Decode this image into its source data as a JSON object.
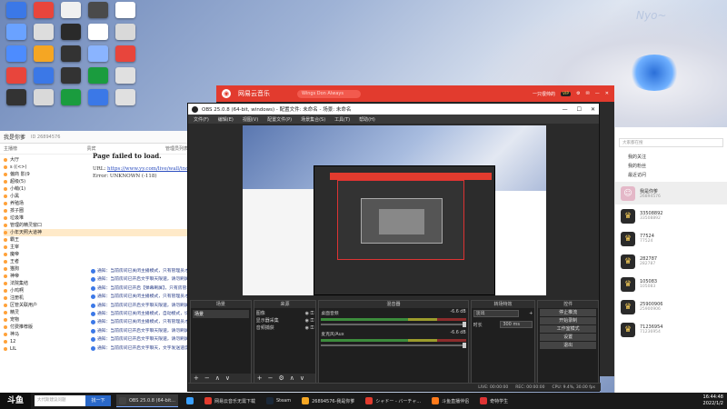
{
  "desktop": {
    "icon_colors": [
      "#3b78e7",
      "#e8453c",
      "#f0f0f0",
      "#4a4a4a",
      "#fff",
      "#6aa2ff",
      "#dddddd",
      "#2a2a2a",
      "#ffffff",
      "#d9d9d9",
      "#4d8cff",
      "#f5a623",
      "#333333",
      "#8ab4ff",
      "#e8453c",
      "#e8453c",
      "#3b78e7",
      "#333333",
      "#1a9c3e",
      "#e0e0e0",
      "#333333",
      "#d9d9d9",
      "#1a9c3e",
      "#3b78e7",
      "#e0e0e0"
    ],
    "wallpaper_text": "Nyo~"
  },
  "client": {
    "room": "我是你爹",
    "room_id": "ID 26894576",
    "tabs": [
      "主播榜",
      "贵宾",
      "管理员列表"
    ],
    "left_items": [
      "大厅",
      "s ((&lt;&gt;)",
      "偏商 影(9",
      "超级(5)",
      "小萌(1)",
      "小黑",
      "养殖场",
      "孩子圈",
      "垃圾堆",
      "管理的精灵窗口",
      "小年天照大道神",
      "霸王",
      "主宰",
      "魔帝",
      "王者",
      "猫狗",
      "神帝",
      "法院集结",
      "小鸡啊",
      "注册机",
      "区管关联用户",
      "精灵",
      "宠物",
      "付费推荐版",
      "神马",
      "12",
      "LIL"
    ],
    "highlight_index": 10
  },
  "webpage": {
    "error_title": "Page failed to load.",
    "url_label": "URL:",
    "url": "https://www.yy.com/live/wall/index.html",
    "error": "Error: UNKNOWN (-118)",
    "notices": [
      "通知：当前房间已关闭主播模式，只有管理员才能",
      "通知：当前房间已开启文字聊天限速，请勿刷屏",
      "通知：当前房间已开启【弹幕刷屏】，只有房管才可以使用",
      "通知：当前房间已关闭主播模式，只有管理员才能",
      "通知：当前房间已开启文字聊天限速，请勿刷屏",
      "通知：当前房间已关闭主播模式，自动模式，切换成功",
      "通知：当前房间已关闭主播模式，只有管理员才能",
      "通知：当前房间已开启文字聊天限速，请勿刷屏",
      "通知：当前房间已开启文字聊天限速，请勿刷屏",
      "通知：当前房间已开启文字聊天，文字发送速度"
    ]
  },
  "music": {
    "app_name": "网易云音乐",
    "search_placeholder": "Wings Don Always",
    "user": "一只很帅的",
    "vip": "VIP"
  },
  "side_panel": {
    "search_placeholder": "大家都在搜",
    "links": [
      "我的关注",
      "我的粉丝",
      "最近访问"
    ],
    "users": [
      {
        "name": "我是你爹",
        "id": "26894576",
        "pink": true
      },
      {
        "name": "33508892",
        "id": "33508892",
        "pink": false
      },
      {
        "name": "77524",
        "id": "77524",
        "pink": false
      },
      {
        "name": "282787",
        "id": "282787",
        "pink": false
      },
      {
        "name": "105083",
        "id": "105083",
        "pink": false
      },
      {
        "name": "25900906",
        "id": "25900906",
        "pink": false
      },
      {
        "name": "71236954",
        "id": "71236954",
        "pink": false
      }
    ]
  },
  "obs": {
    "title": "OBS 25.0.8 (64-bit, windows) - 配置文件: 未命名 - 场景: 未命名",
    "menu": [
      "文件(F)",
      "编辑(E)",
      "视图(V)",
      "配置文件(P)",
      "场景集合(S)",
      "工具(T)",
      "帮助(H)"
    ],
    "docks": {
      "scenes": "场景",
      "sources": "来源",
      "mixer": "混音器",
      "transitions": "转场特效",
      "controls": "控件"
    },
    "scene_items": [
      "场景"
    ],
    "sources": [
      "图像",
      "显示器采集",
      "音频捕获"
    ],
    "mixer": [
      {
        "name": "桌面音频",
        "db": "-6.6 dB"
      },
      {
        "name": "麦克风/Aux",
        "db": "-6.6 dB"
      }
    ],
    "transition": "淡出",
    "duration_label": "时长",
    "duration": "300 ms",
    "controls": [
      "停止推流",
      "开始录制",
      "工作室模式",
      "设置",
      "退出"
    ],
    "status": [
      "LIVE: 00:00:00",
      "REC: 00:00:00",
      "CPU: 9.4%, 30.00 fps"
    ]
  },
  "taskbar": {
    "logo": "斗鱼",
    "search_placeholder": "大代斯建议问题",
    "search_button": "找一下",
    "apps": [
      {
        "label": "OBS 25.0.8 (64-bit...",
        "color": "#444444",
        "active": true
      },
      {
        "label": "",
        "color": "#3aa0ff",
        "active": false
      },
      {
        "label": "网易云音乐无需下载",
        "color": "#e23b2e",
        "active": false
      },
      {
        "label": "Steam",
        "color": "#1b2838",
        "active": false
      },
      {
        "label": "26894576-我是你爹",
        "color": "#f5a623",
        "active": false
      },
      {
        "label": "シャドー - バーチャ...",
        "color": "#e23b2e",
        "active": false
      },
      {
        "label": "斗鱼直播伴侣",
        "color": "#ff7a1a",
        "active": false
      },
      {
        "label": "奇特学生",
        "color": "#d33",
        "active": false
      }
    ],
    "time": "16:44:48",
    "date": "2022/1/2"
  }
}
